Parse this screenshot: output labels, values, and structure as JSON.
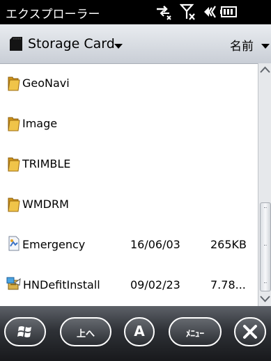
{
  "status_bar": {
    "title": "エクスプローラー",
    "icons": [
      "connectivity-icon",
      "signal-off-icon",
      "volume-icon",
      "battery-icon"
    ]
  },
  "header": {
    "location": "Storage Card",
    "sort_label": "名前"
  },
  "files": [
    {
      "name": "GeoNavi",
      "type": "folder",
      "date": "",
      "size": ""
    },
    {
      "name": "Image",
      "type": "folder",
      "date": "",
      "size": ""
    },
    {
      "name": "TRIMBLE",
      "type": "folder",
      "date": "",
      "size": ""
    },
    {
      "name": "WMDRM",
      "type": "folder",
      "date": "",
      "size": ""
    },
    {
      "name": "Emergency",
      "type": "document",
      "date": "16/06/03",
      "size": "265KB"
    },
    {
      "name": "HNDefitInstall",
      "type": "installer",
      "date": "09/02/23",
      "size": "7.78..."
    }
  ],
  "soft_keys": {
    "start_icon": "windows-logo-icon",
    "up_label": "上へ",
    "ime_label": "A",
    "menu_label": "ﾒﾆｭｰ",
    "close_icon": "close-icon"
  },
  "colors": {
    "folder": "#e7b22a",
    "header_bg": "#d6dae0",
    "softbar_bg": "#2e3136"
  }
}
